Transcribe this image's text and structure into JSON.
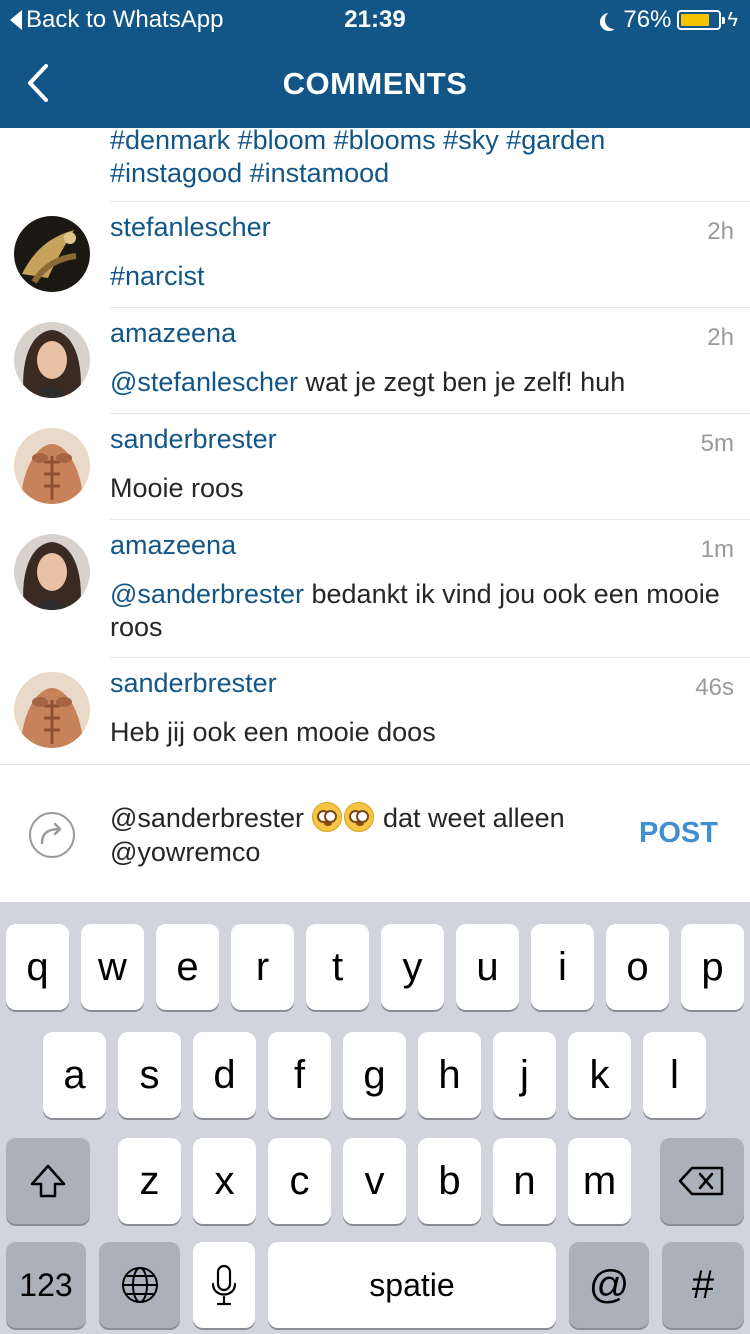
{
  "status_bar": {
    "back_label": "Back to WhatsApp",
    "time": "21:39",
    "battery": "76%",
    "battery_level": 0.76,
    "battery_color": "#f5c400"
  },
  "nav": {
    "title": "COMMENTS",
    "back_icon": "chevron-left-icon"
  },
  "caption": {
    "line1": "#denmark #bloom #blooms #sky #garden",
    "line2": "#instagood #instamood"
  },
  "comments": [
    {
      "user": "stefanlescher",
      "time": "2h",
      "mention": "",
      "text": "#narcist",
      "text_is_tag": true
    },
    {
      "user": "amazeena",
      "time": "2h",
      "mention": "@stefanlescher",
      "text": " wat je zegt ben je zelf! huh"
    },
    {
      "user": "sanderbrester",
      "time": "5m",
      "mention": "",
      "text": "Mooie roos"
    },
    {
      "user": "amazeena",
      "time": "1m",
      "mention": "@sanderbrester",
      "text": " bedankt ik vind jou ook een mooie roos"
    },
    {
      "user": "sanderbrester",
      "time": "46s",
      "mention": "",
      "text": "Heb jij ook een mooie doos"
    }
  ],
  "input": {
    "part1": "@sanderbrester",
    "part2": " dat weet alleen",
    "part3": "@yowremco",
    "post_label": "POST"
  },
  "keyboard": {
    "row1": [
      "q",
      "w",
      "e",
      "r",
      "t",
      "y",
      "u",
      "i",
      "o",
      "p"
    ],
    "row2": [
      "a",
      "s",
      "d",
      "f",
      "g",
      "h",
      "j",
      "k",
      "l"
    ],
    "row3": [
      "z",
      "x",
      "c",
      "v",
      "b",
      "n",
      "m"
    ],
    "numbers_label": "123",
    "space_label": "spatie",
    "at_label": "@",
    "hash_label": "#"
  },
  "colors": {
    "brand": "#125688",
    "post": "#3f8fd2",
    "keyboard_bg": "#d1d4da"
  }
}
